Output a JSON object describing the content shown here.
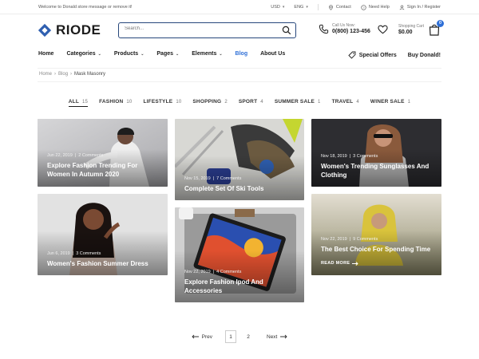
{
  "topbar": {
    "welcome": "Welcome to Donald store message or remove it!",
    "currency": "USD",
    "language": "ENG",
    "contact": "Contact",
    "help": "Need Help",
    "account": "Sign In / Register"
  },
  "header": {
    "logo_text": "RIODE",
    "search_placeholder": "Search...",
    "call_label": "Call Us Now:",
    "call_number": "0(800) 123-456",
    "cart_label": "Shopping Cart",
    "cart_amount": "$0.00",
    "cart_count": "0"
  },
  "nav": {
    "items": [
      {
        "label": "Home"
      },
      {
        "label": "Categories"
      },
      {
        "label": "Products"
      },
      {
        "label": "Pages"
      },
      {
        "label": "Elements"
      },
      {
        "label": "Blog"
      },
      {
        "label": "About Us"
      }
    ],
    "special_offers": "Special Offers",
    "buy": "Buy Donald!"
  },
  "breadcrumb": {
    "home": "Home",
    "blog": "Blog",
    "current": "Mask Masonry",
    "separator": "›"
  },
  "filters": [
    {
      "label": "ALL",
      "count": "15"
    },
    {
      "label": "FASHION",
      "count": "10"
    },
    {
      "label": "LIFESTYLE",
      "count": "10"
    },
    {
      "label": "SHOPPING",
      "count": "2"
    },
    {
      "label": "SPORT",
      "count": "4"
    },
    {
      "label": "SUMMER SALE",
      "count": "1"
    },
    {
      "label": "TRAVEL",
      "count": "4"
    },
    {
      "label": "WINER SALE",
      "count": "1"
    }
  ],
  "posts": [
    {
      "date": "Jun 22, 2019",
      "comments": "2 Comments",
      "title": "Explore Fashion Trending For Women In Autumn 2020"
    },
    {
      "date": "Nov 18, 2019",
      "comments": "3 Comments",
      "title": "Women's Trending Sunglasses And Clothing"
    },
    {
      "date": "Nov 15, 2019",
      "comments": "7 Comments",
      "title": "Complete Set Of Ski Tools"
    },
    {
      "date": "Jun 6, 2019",
      "comments": "3 Comments",
      "title": "Women's Fashion Summer Dress"
    },
    {
      "date": "Nov 22, 2019",
      "comments": "4 Comments",
      "title": "Explore Fashion Ipod And Accessories"
    },
    {
      "date": "Nov 22, 2019",
      "comments": "9 Comments",
      "title": "The Best Choice For Spending Time",
      "more": "READ MORE"
    }
  ],
  "meta_separator": "|",
  "pagination": {
    "prev": "Prev",
    "pages": [
      "1",
      "2"
    ],
    "next": "Next"
  },
  "colors": {
    "accent": "#2e6fd7",
    "search_border": "#27477b",
    "logo_blue": "#2f5fb0"
  }
}
